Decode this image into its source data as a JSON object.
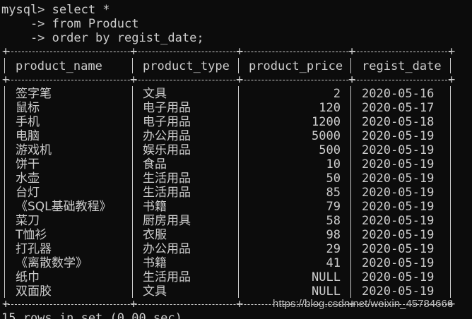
{
  "query": {
    "line1": "mysql> select *",
    "line2": "    -> from Product",
    "line3": "    -> order by regist_date;"
  },
  "table": {
    "columns": [
      "product_name",
      "product_type",
      "product_price",
      "regist_date"
    ],
    "rows": [
      [
        "签字笔",
        "文具",
        "2",
        "2020-05-16"
      ],
      [
        "鼠标",
        "电子用品",
        "120",
        "2020-05-17"
      ],
      [
        "手机",
        "电子用品",
        "1200",
        "2020-05-18"
      ],
      [
        "电脑",
        "办公用品",
        "5000",
        "2020-05-19"
      ],
      [
        "游戏机",
        "娱乐用品",
        "500",
        "2020-05-19"
      ],
      [
        "饼干",
        "食品",
        "10",
        "2020-05-19"
      ],
      [
        "水壶",
        "生活用品",
        "50",
        "2020-05-19"
      ],
      [
        "台灯",
        "生活用品",
        "85",
        "2020-05-19"
      ],
      [
        "《SQL基础教程》",
        "书籍",
        "79",
        "2020-05-19"
      ],
      [
        "菜刀",
        "厨房用具",
        "58",
        "2020-05-19"
      ],
      [
        "T恤衫",
        "衣服",
        "98",
        "2020-05-19"
      ],
      [
        "打孔器",
        "办公用品",
        "29",
        "2020-05-19"
      ],
      [
        "《离散数学》",
        "书籍",
        "41",
        "2020-05-19"
      ],
      [
        "纸巾",
        "生活用品",
        "NULL",
        "2020-05-19"
      ],
      [
        "双面胶",
        "文具",
        "NULL",
        "2020-05-19"
      ]
    ]
  },
  "footer": "15 rows in set (0.00 sec)",
  "watermark": "https://blog.csdn.net/weixin_45784666",
  "colors": {
    "background": "#0c0c0c",
    "text": "#cccccc"
  }
}
